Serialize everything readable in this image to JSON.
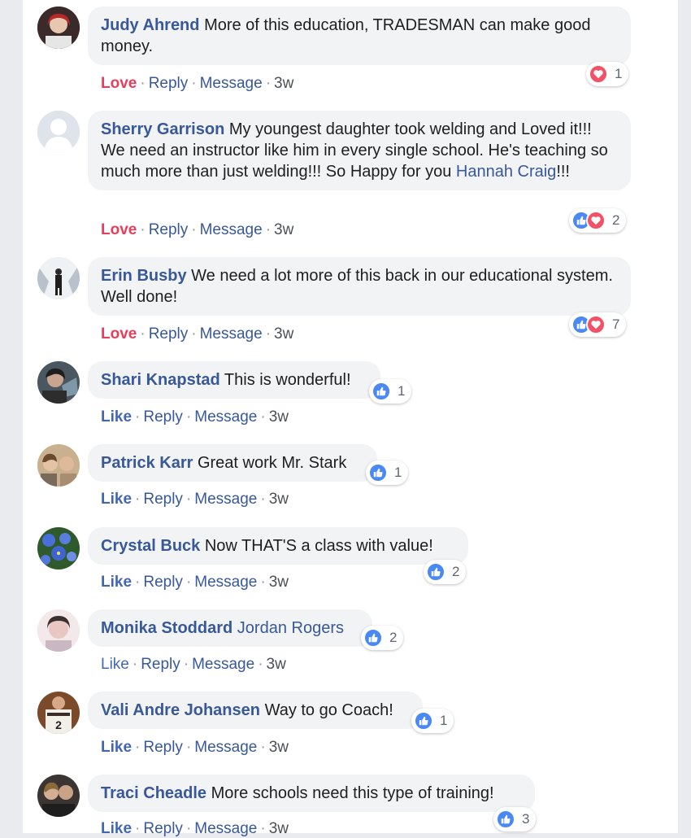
{
  "comments": [
    {
      "author": "Judy Ahrend",
      "text": "More of this education, TRADESMAN can make good money.",
      "mention": "",
      "text_after": "",
      "action_react": "Love",
      "reply": "Reply",
      "message": "Message",
      "time": "3w",
      "reactions": [
        "heart"
      ],
      "count": "1"
    },
    {
      "author": "Sherry Garrison",
      "text": "My youngest daughter took welding and Loved it!!! We need an instructor like him in every single school. He's teaching so much more than just welding!!! So Happy for you",
      "mention": "Hannah Craig",
      "text_after": "!!!",
      "action_react": "Love",
      "reply": "Reply",
      "message": "Message",
      "time": "3w",
      "reactions": [
        "like",
        "heart"
      ],
      "count": "2"
    },
    {
      "author": "Erin Busby",
      "text": "We need a lot more of this back in our educational system. Well done!",
      "mention": "",
      "text_after": "",
      "action_react": "Love",
      "reply": "Reply",
      "message": "Message",
      "time": "3w",
      "reactions": [
        "like",
        "heart"
      ],
      "count": "7"
    },
    {
      "author": "Shari Knapstad",
      "text": "This is wonderful!",
      "mention": "",
      "text_after": "",
      "action_react": "Like",
      "reply": "Reply",
      "message": "Message",
      "time": "3w",
      "reactions": [
        "like"
      ],
      "count": "1"
    },
    {
      "author": "Patrick Karr",
      "text": "Great work Mr. Stark",
      "mention": "",
      "text_after": "",
      "action_react": "Like",
      "reply": "Reply",
      "message": "Message",
      "time": "3w",
      "reactions": [
        "like"
      ],
      "count": "1"
    },
    {
      "author": "Crystal Buck",
      "text": "Now THAT'S a class with value!",
      "mention": "",
      "text_after": "",
      "action_react": "Like",
      "reply": "Reply",
      "message": "Message",
      "time": "3w",
      "reactions": [
        "like"
      ],
      "count": "2"
    },
    {
      "author": "Monika Stoddard",
      "text": "",
      "mention": "Jordan Rogers",
      "text_after": "",
      "action_react": "Like",
      "reply": "Reply",
      "message": "Message",
      "time": "3w",
      "reactions": [
        "like"
      ],
      "count": "2"
    },
    {
      "author": "Vali Andre Johansen",
      "text": "Way to go Coach!",
      "mention": "",
      "text_after": "",
      "action_react": "Like",
      "reply": "Reply",
      "message": "Message",
      "time": "3w",
      "reactions": [
        "like"
      ],
      "count": "1"
    },
    {
      "author": "Traci Cheadle",
      "text": "More schools need this type of training!",
      "mention": "",
      "text_after": "",
      "action_react": "Like",
      "reply": "Reply",
      "message": "Message",
      "time": "3w",
      "reactions": [
        "like"
      ],
      "count": "3"
    }
  ],
  "colors": {
    "author_link": "#385898",
    "love": "#e63e5c",
    "like": "#4267b2",
    "bubble": "#f2f3f5",
    "like_icon": "#4a89f3",
    "heart_icon": "#f25268"
  }
}
